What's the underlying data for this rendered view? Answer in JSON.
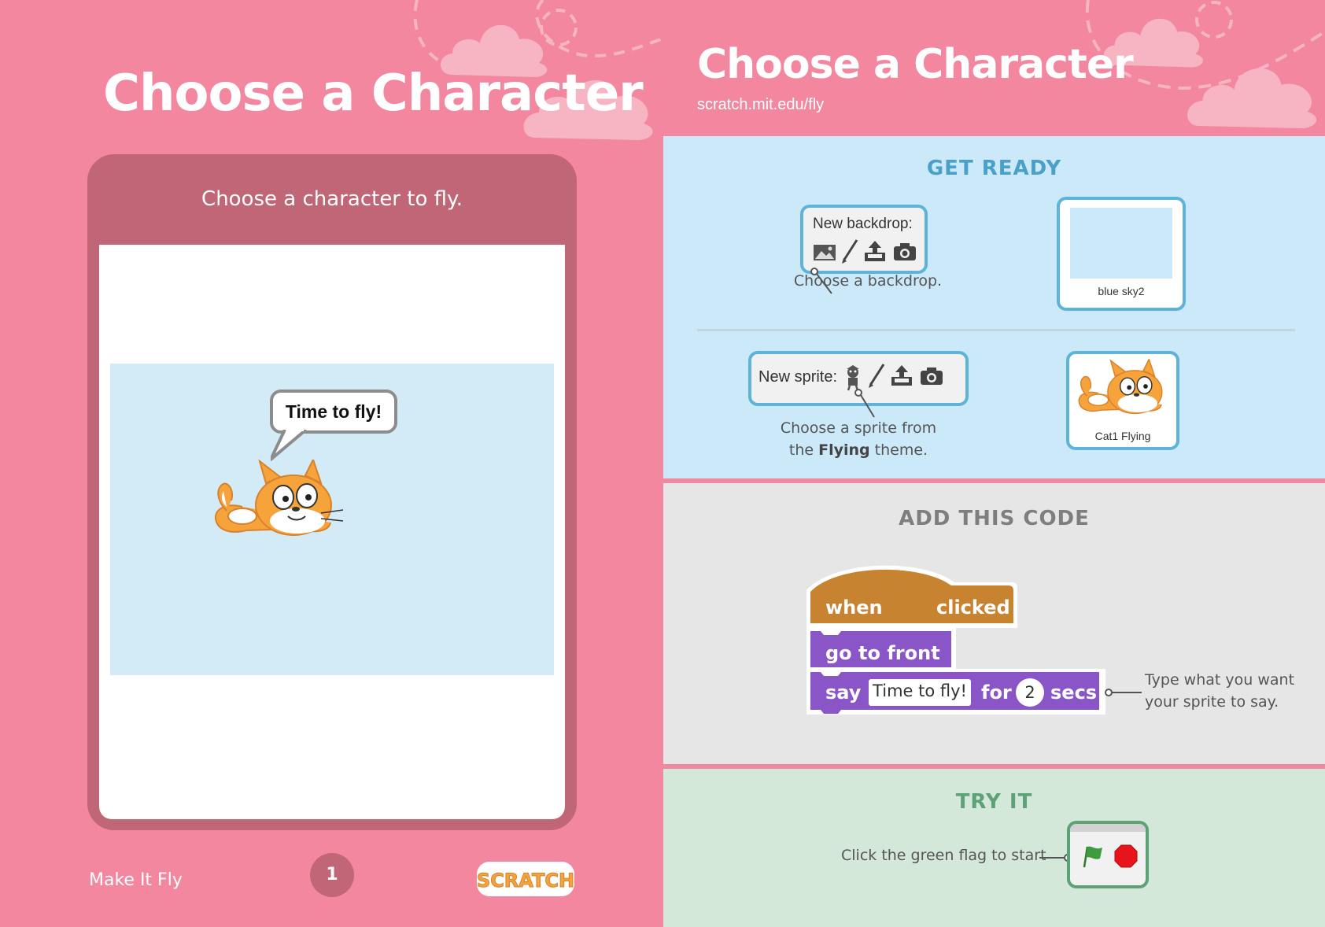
{
  "left_page": {
    "title": "Choose a Character",
    "card_caption": "Choose a character to fly.",
    "speech_bubble": "Time to fly!",
    "footer_title": "Make It Fly",
    "page_number": "1",
    "logo_text": "SCRATCH"
  },
  "right_page": {
    "title": "Choose a Character",
    "url": "scratch.mit.edu/fly",
    "get_ready": {
      "heading": "GET READY",
      "backdrop_panel_label": "New backdrop:",
      "backdrop_caption": "Choose a backdrop.",
      "backdrop_thumb_label": "blue sky2",
      "sprite_panel_label": "New sprite:",
      "sprite_caption_line1": "Choose a sprite from",
      "sprite_caption_line2_pre": "the ",
      "sprite_caption_bold": "Flying",
      "sprite_caption_line2_post": " theme.",
      "sprite_thumb_label": "Cat1 Flying"
    },
    "add_code": {
      "heading": "ADD THIS CODE",
      "hat_when": "when",
      "hat_clicked": "clicked",
      "motion_block": "go to front",
      "say_word": "say",
      "say_input": "Time to fly!",
      "for_word": "for",
      "secs_value": "2",
      "secs_word": "secs",
      "note_line1": "Type what you want",
      "note_line2": "your sprite to say."
    },
    "try_it": {
      "heading": "TRY IT",
      "caption": "Click the green flag to start"
    }
  },
  "colors": {
    "page_pink": "#f2879f",
    "card_dark_pink": "#c06677",
    "stage_blue": "#d3ebf7",
    "ready_blue": "#cbe9f8",
    "code_gray": "#e6e6e6",
    "try_green": "#d3e8d9",
    "events_block": "#c88330",
    "looks_block": "#8a55c6",
    "flag_green": "#3e9b3e",
    "stop_red": "#e8141b"
  },
  "icons": [
    "image-icon",
    "paintbrush-icon",
    "upload-icon",
    "camera-icon",
    "sprite-library-icon",
    "green-flag-icon",
    "stop-icon",
    "scratch-cat-icon",
    "cloud-icon"
  ]
}
